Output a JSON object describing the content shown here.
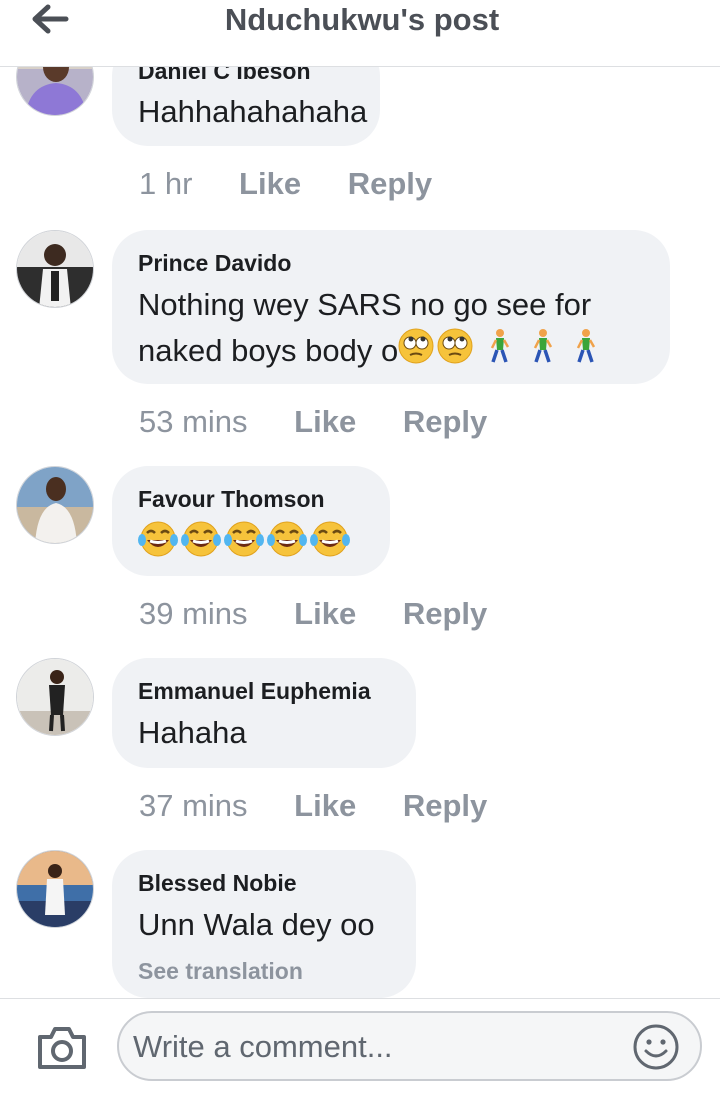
{
  "header": {
    "title": "Nduchukwu's post"
  },
  "comments": [
    {
      "author": "Daniel C Ibeson",
      "text": "Hahhahahahaha",
      "time": "1 hr",
      "like": "Like",
      "reply": "Reply"
    },
    {
      "author": "Prince Davido",
      "text_line1": "Nothing wey SARS no go see for",
      "text_line2": "naked boys body o",
      "time": "53 mins",
      "like": "Like",
      "reply": "Reply",
      "emojis": [
        "eye-roll-emoji",
        "eye-roll-emoji",
        "walking-person-emoji",
        "walking-person-emoji",
        "walking-person-emoji"
      ]
    },
    {
      "author": "Favour Thomson",
      "time": "39 mins",
      "like": "Like",
      "reply": "Reply",
      "emojis": [
        "tears-of-joy-emoji",
        "tears-of-joy-emoji",
        "tears-of-joy-emoji",
        "tears-of-joy-emoji",
        "tears-of-joy-emoji"
      ]
    },
    {
      "author": "Emmanuel Euphemia",
      "text": "Hahaha",
      "time": "37 mins",
      "like": "Like",
      "reply": "Reply"
    },
    {
      "author": "Blessed Nobie",
      "text": "Unn Wala dey oo",
      "see_translation": "See translation"
    }
  ],
  "composer": {
    "placeholder": "Write a comment..."
  },
  "icons": {
    "back": "arrow-left-icon",
    "camera": "camera-icon",
    "emoji": "smiley-icon"
  },
  "colors": {
    "bubble": "#f0f2f5",
    "muted": "#8d949e",
    "header_text": "#4b4f56"
  }
}
